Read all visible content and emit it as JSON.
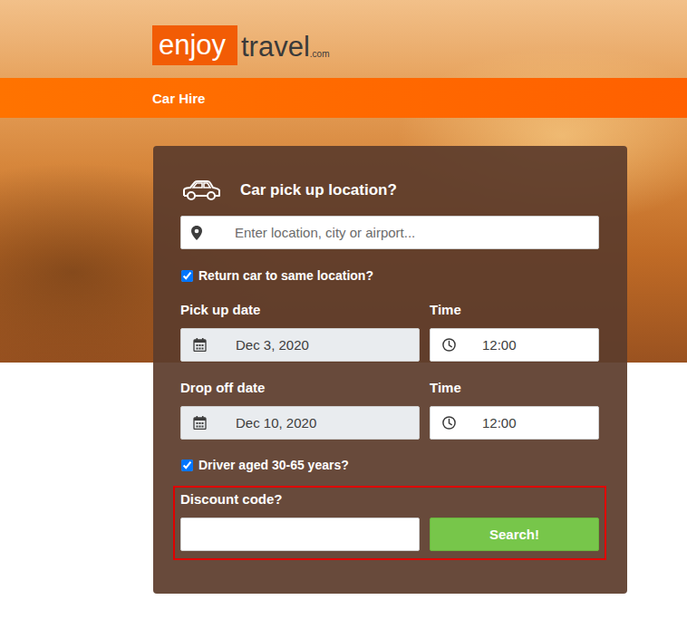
{
  "logo": {
    "brand": "enjoy",
    "suffix": "travel",
    "tld": ".com"
  },
  "nav": {
    "items": [
      {
        "label": "Car Hire",
        "selected": true
      }
    ]
  },
  "form": {
    "heading": "Car pick up location?",
    "location": {
      "placeholder": "Enter location, city or airport..."
    },
    "returnSame": {
      "label": "Return car to same location?",
      "checked": true
    },
    "pickup": {
      "dateLabel": "Pick up date",
      "date": "Dec 3, 2020",
      "timeLabel": "Time",
      "time": "12:00"
    },
    "dropoff": {
      "dateLabel": "Drop off date",
      "date": "Dec 10, 2020",
      "timeLabel": "Time",
      "time": "12:00"
    },
    "driverAge": {
      "label": "Driver aged 30-65 years?",
      "checked": true
    },
    "discount": {
      "label": "Discount code?",
      "value": "",
      "highlighted": true
    },
    "searchButton": "Search!"
  }
}
